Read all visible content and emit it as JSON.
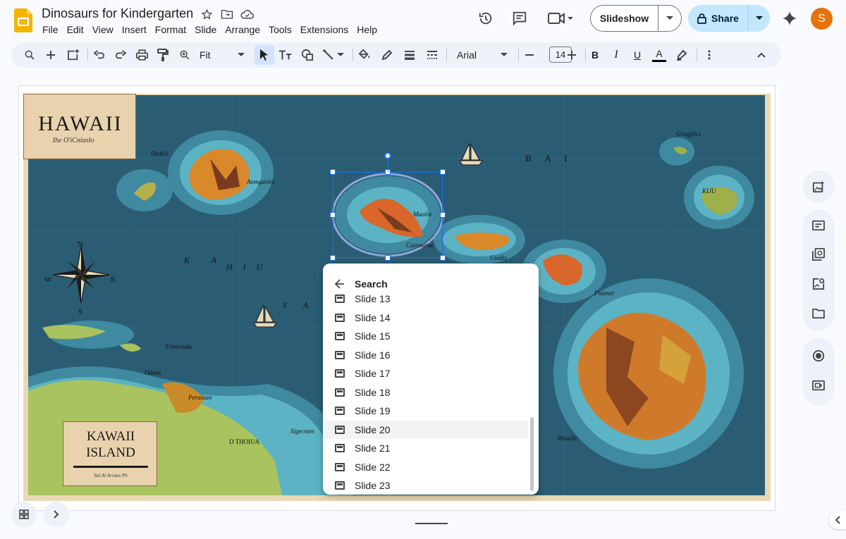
{
  "app": {
    "doc_title": "Dinosaurs for Kindergarten",
    "menu": [
      "File",
      "Edit",
      "View",
      "Insert",
      "Format",
      "Slide",
      "Arrange",
      "Tools",
      "Extensions",
      "Help"
    ],
    "slideshow_label": "Slideshow",
    "share_label": "Share",
    "avatar_letter": "S",
    "colors": {
      "accent_blue": "#1a73e8",
      "share_bg": "#c2e7ff",
      "avatar": "#e8710a"
    }
  },
  "toolbar": {
    "zoom_label": "Fit",
    "font_name": "Arial",
    "font_size": "14",
    "bold": "B",
    "italic": "I",
    "underline": "U",
    "text_color": "A"
  },
  "slide": {
    "title_main": "HAWAII",
    "title_sub": "Ihe O'iCniaslo",
    "inset_title_line1": "KAWAII",
    "inset_title_line2": "ISLAND",
    "inset_caption": "Sul Al Arruus P6",
    "compass": {
      "n": "N",
      "s": "S",
      "e": "E",
      "w": "W"
    },
    "labels": [
      {
        "text": "Dwkiis"
      },
      {
        "text": "Anmgaviro"
      },
      {
        "text": "B A I"
      },
      {
        "text": "Gimgjlics"
      },
      {
        "text": "KIJU"
      },
      {
        "text": "Muoiin"
      },
      {
        "text": "Cuvsourne"
      },
      {
        "text": "K A"
      },
      {
        "text": "H I U"
      },
      {
        "text": "S A U"
      },
      {
        "text": "Uuidts"
      },
      {
        "text": "Fiuimet"
      },
      {
        "text": "Fimrcluda"
      },
      {
        "text": "Odnas"
      },
      {
        "text": "Peraluan"
      },
      {
        "text": "D THOIUA"
      },
      {
        "text": "Sigecnies"
      },
      {
        "text": "Bhualie"
      }
    ]
  },
  "search_popup": {
    "title": "Search",
    "items": [
      "Slide 13",
      "Slide 14",
      "Slide 15",
      "Slide 16",
      "Slide 17",
      "Slide 18",
      "Slide 19",
      "Slide 20",
      "Slide 21",
      "Slide 22",
      "Slide 23"
    ],
    "highlighted": "Slide 20"
  }
}
